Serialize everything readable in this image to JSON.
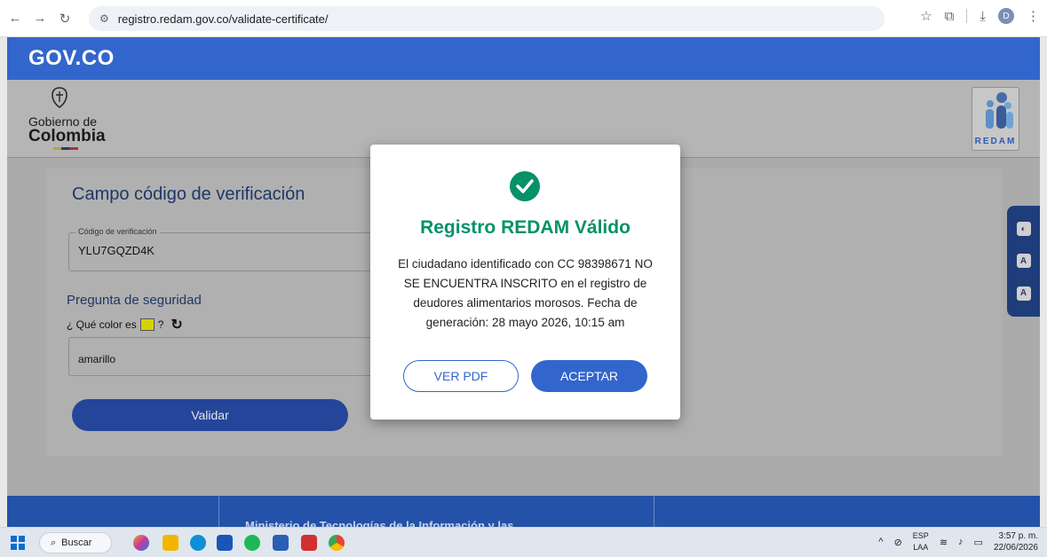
{
  "browser": {
    "url": "registro.redam.gov.co/validate-certificate/",
    "profile_initial": "D"
  },
  "gov_bar": {
    "logo_text": "GOV.CO"
  },
  "header": {
    "gobierno_line1": "Gobierno de",
    "gobierno_line2": "Colombia",
    "redam_logo_text": "REDAM"
  },
  "form": {
    "title": "Campo código de verificación",
    "code_label": "Código de verificación",
    "code_value": "YLU7GQZD4K",
    "security_title": "Pregunta de seguridad",
    "security_question_prefix": "¿ Qué color es",
    "security_question_suffix": "?",
    "swatch_color": "#d4d400",
    "answer_value": "amarillo",
    "validate_label": "Validar"
  },
  "modal": {
    "title": "Registro REDAM Válido",
    "message": "El ciudadano identificado con CC 98398671 NO SE ENCUENTRA INSCRITO en el registro de deudores alimentarios morosos. Fecha de generación: 28 mayo 2026, 10:15 am",
    "pdf_label": "VER PDF",
    "accept_label": "ACEPTAR",
    "accent_color": "#069169",
    "button_color": "#3366cc"
  },
  "footer": {
    "text": "Ministerio de Tecnologías de la Información y las"
  },
  "taskbar": {
    "search_label": "Buscar",
    "lang_line1": "ESP",
    "lang_line2": "LAA",
    "time": "3:57 p. m.",
    "date": "22/06/2026"
  }
}
